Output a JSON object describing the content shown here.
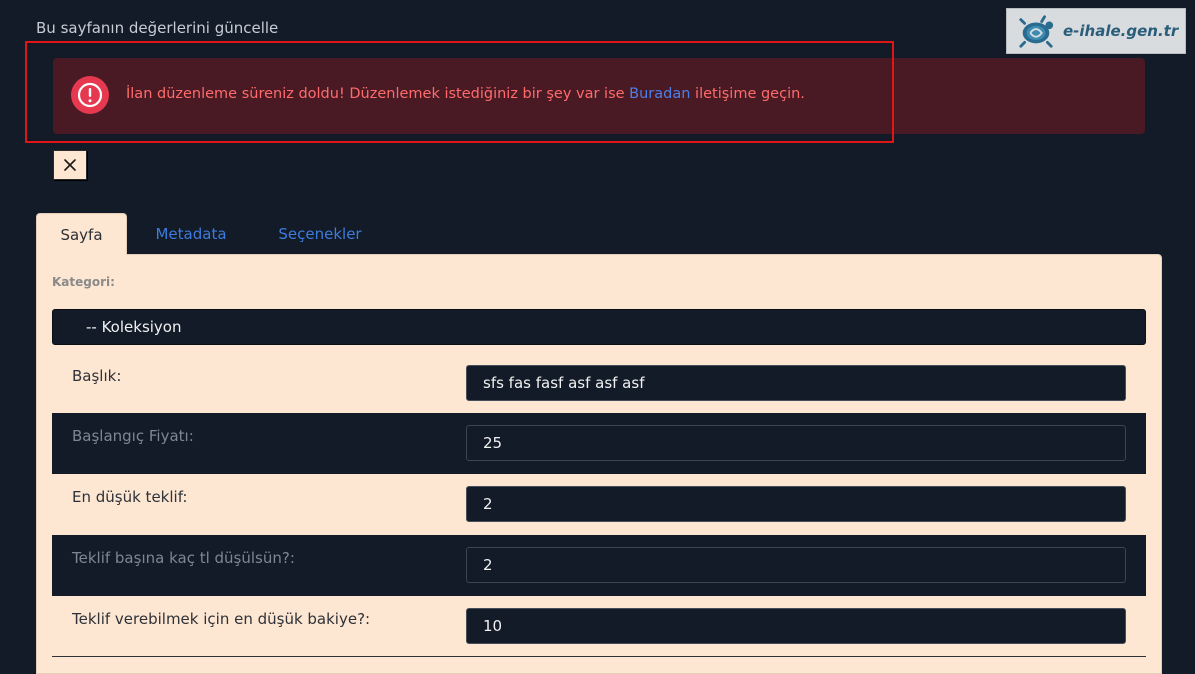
{
  "page": {
    "heading": "Bu sayfanın değerlerini güncelle"
  },
  "brand": {
    "name": "e-ihale.gen.tr",
    "logo_icon": "turtle-logo-icon"
  },
  "alert": {
    "icon": "exclamation-circle-icon",
    "text_before": "İlan düzenleme süreniz doldu! Düzenlemek istediğiniz bir şey var ise ",
    "link_text": "Buradan",
    "text_after": " iletişime geçin.",
    "accent_color": "#e63950",
    "text_color": "#ff6b6b"
  },
  "close_button": {
    "icon": "close-icon",
    "label": "×"
  },
  "tabs": [
    {
      "label": "Sayfa",
      "active": true
    },
    {
      "label": "Metadata",
      "active": false
    },
    {
      "label": "Seçenekler",
      "active": false
    }
  ],
  "form": {
    "category": {
      "label": "Kategori:",
      "selected": "-- Koleksiyon"
    },
    "fields": [
      {
        "label": "Başlık:",
        "value": "sfs fas fasf asf asf asf",
        "dark": false
      },
      {
        "label": "Başlangıç Fiyatı:",
        "value": "25",
        "dark": true
      },
      {
        "label": "En düşük teklif:",
        "value": "2",
        "dark": false
      },
      {
        "label": "Teklif başına kaç tl düşülsün?:",
        "value": "2",
        "dark": true
      },
      {
        "label": "Teklif verebilmek için en düşük bakiye?:",
        "value": "10",
        "dark": false
      }
    ]
  },
  "colors": {
    "background": "#121b27",
    "panel": "#fde6d2",
    "link": "#3d7bdc",
    "highlight_border": "#e01515"
  }
}
